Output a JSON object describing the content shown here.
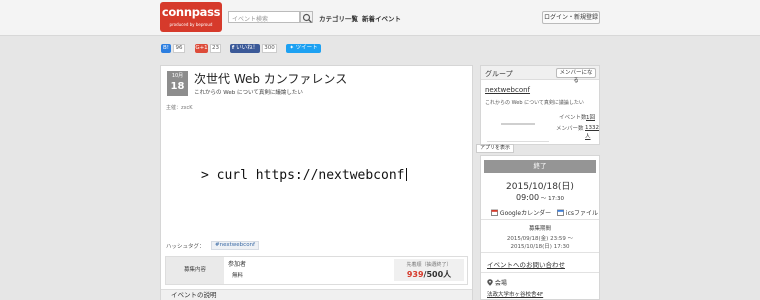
{
  "header": {
    "logo": "connpass",
    "logo_sub": "produced by beproud",
    "search_placeholder": "イベント検索",
    "nav_categories": "カテゴリ一覧",
    "nav_new_events": "新着イベント",
    "login_label": "ログイン・新規登録"
  },
  "share": {
    "hatena_label": "B!",
    "hatena_count": "96",
    "gplus_label": "G+1",
    "gplus_count": "23",
    "fb_label": "いいね！",
    "fb_count": "300",
    "tweet_label": "ツイート"
  },
  "event": {
    "month": "10月",
    "day": "18",
    "title": "次世代 Web カンファレンス",
    "catch": "これからの Web について真剣に議論したい",
    "organizer": "主催：zxcK",
    "cover_text": "> curl https://nextwebconf",
    "hashtag_label": "ハッシュタグ：",
    "hashtag": "#nextwebconf",
    "registration": {
      "header": "募集内容",
      "type": "参加者",
      "fee": "無料",
      "note": "先着順（抽選終了）",
      "accepted": "939",
      "capacity": "/500人"
    },
    "description_heading": "イベントの説明"
  },
  "group": {
    "heading": "グループ",
    "join_label": "メンバーになる",
    "name": "nextwebconf",
    "catch": "これからの Web について真剣に議論したい",
    "events_label": "イベント数",
    "events_count": "1回",
    "members_label": "メンバー数",
    "members_count": "1332人"
  },
  "app_label": "アプリを表示",
  "sidebar": {
    "status": "終了",
    "date": "2015/10/18(日)",
    "time_start": "09:00",
    "time_sep": " ～ ",
    "time_end": "17:30",
    "gcal_label": "Googleカレンダー",
    "ics_label": "icsファイル",
    "period_label": "募集期間",
    "period_start": "2015/09/18(金) 23:59 ～",
    "period_end": "2015/10/18(日) 17:30",
    "contact_label": "イベントへのお問い合わせ",
    "venue_label": "会場",
    "venue": "法政大学市ヶ谷校舎4F"
  },
  "colors": {
    "brand": "#d63a2b",
    "facebook": "#3b5998",
    "twitter": "#1da1f2",
    "hatena": "#2c7ee0",
    "gplus": "#dd4b39"
  }
}
